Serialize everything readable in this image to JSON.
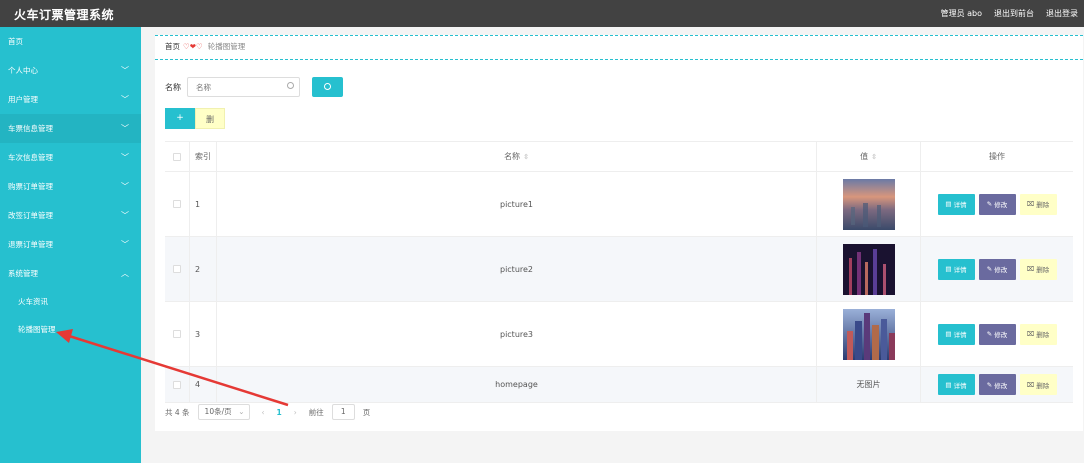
{
  "app": {
    "title": "火车订票管理系统"
  },
  "header": {
    "user_label": "管理员 abo",
    "back_label": "退出到前台",
    "logout_label": "退出登录"
  },
  "sidebar": {
    "items": [
      {
        "label": "首页"
      },
      {
        "label": "个人中心"
      },
      {
        "label": "用户管理"
      },
      {
        "label": "车票信息管理"
      },
      {
        "label": "车次信息管理"
      },
      {
        "label": "购票订单管理"
      },
      {
        "label": "改签订单管理"
      },
      {
        "label": "退票订单管理"
      },
      {
        "label": "系统管理"
      }
    ],
    "sub_items": [
      {
        "label": "火车资讯"
      },
      {
        "label": "轮播图管理"
      }
    ]
  },
  "breadcrumb": {
    "home": "首页",
    "current": "轮播图管理"
  },
  "search": {
    "label": "名称",
    "placeholder": "名称"
  },
  "toolbar": {
    "add_label": "+",
    "delete_label": "删"
  },
  "table": {
    "headers": {
      "index": "索引",
      "name": "名称",
      "image": "值",
      "ops": "操作"
    },
    "rows": [
      {
        "index": "1",
        "name": "picture1",
        "image_text": ""
      },
      {
        "index": "2",
        "name": "picture2",
        "image_text": ""
      },
      {
        "index": "3",
        "name": "picture3",
        "image_text": ""
      },
      {
        "index": "4",
        "name": "homepage",
        "image_text": "无图片"
      }
    ],
    "op_labels": {
      "detail": "详情",
      "edit": "修改",
      "remove": "删除"
    }
  },
  "pager": {
    "total": "共 4 条",
    "page_size": "10条/页",
    "current_page": "1",
    "goto_label": "前往",
    "goto_value": "1",
    "page_unit": "页"
  },
  "colors": {
    "accent": "#26c0cf",
    "topbar": "#424242",
    "edit": "#6a6a9f",
    "delete": "#ffffc7",
    "annotation_arrow": "#e53935"
  }
}
